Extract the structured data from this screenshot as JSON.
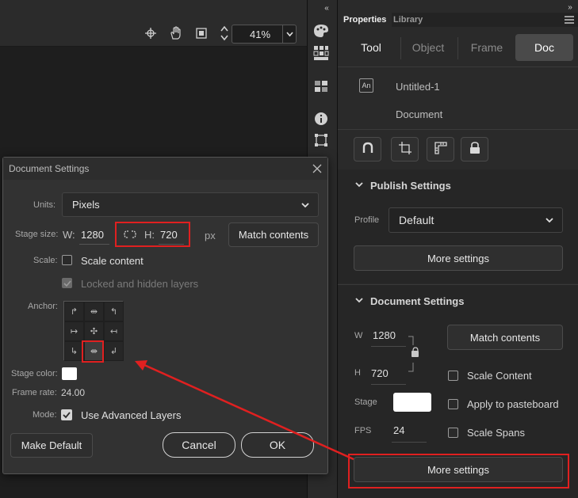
{
  "toolbar": {
    "zoom_value": "41%"
  },
  "panel": {
    "tabs": [
      "Properties",
      "Library"
    ],
    "segments": [
      "Tool",
      "Object",
      "Frame",
      "Doc"
    ],
    "doc_icon_label": "An",
    "doc_name": "Untitled-1",
    "doc_type": "Document",
    "publish": {
      "title": "Publish Settings",
      "profile_label": "Profile",
      "profile_value": "Default",
      "more_settings": "More settings"
    },
    "doc_settings": {
      "title": "Document Settings",
      "w_label": "W",
      "w_value": "1280",
      "h_label": "H",
      "h_value": "720",
      "match_contents": "Match contents",
      "scale_content": "Scale Content",
      "apply_pasteboard": "Apply to pasteboard",
      "scale_spans": "Scale Spans",
      "stage_label": "Stage",
      "fps_label": "FPS",
      "fps_value": "24",
      "more_settings": "More settings"
    }
  },
  "dialog": {
    "title": "Document Settings",
    "units_label": "Units:",
    "units_value": "Pixels",
    "stage_size_label": "Stage size:",
    "w_label": "W:",
    "w_value": "1280",
    "h_label": "H:",
    "h_value": "720",
    "px_label": "px",
    "match_contents": "Match contents",
    "scale_label": "Scale:",
    "scale_content": "Scale content",
    "locked_layers": "Locked and hidden layers",
    "anchor_label": "Anchor:",
    "stage_color_label": "Stage color:",
    "frame_rate_label": "Frame rate:",
    "frame_rate_value": "24.00",
    "mode_label": "Mode:",
    "use_advanced_layers": "Use Advanced Layers",
    "make_default": "Make Default",
    "cancel": "Cancel",
    "ok": "OK"
  },
  "colors": {
    "highlight": "#e02020",
    "stage_color": "#ffffff"
  }
}
